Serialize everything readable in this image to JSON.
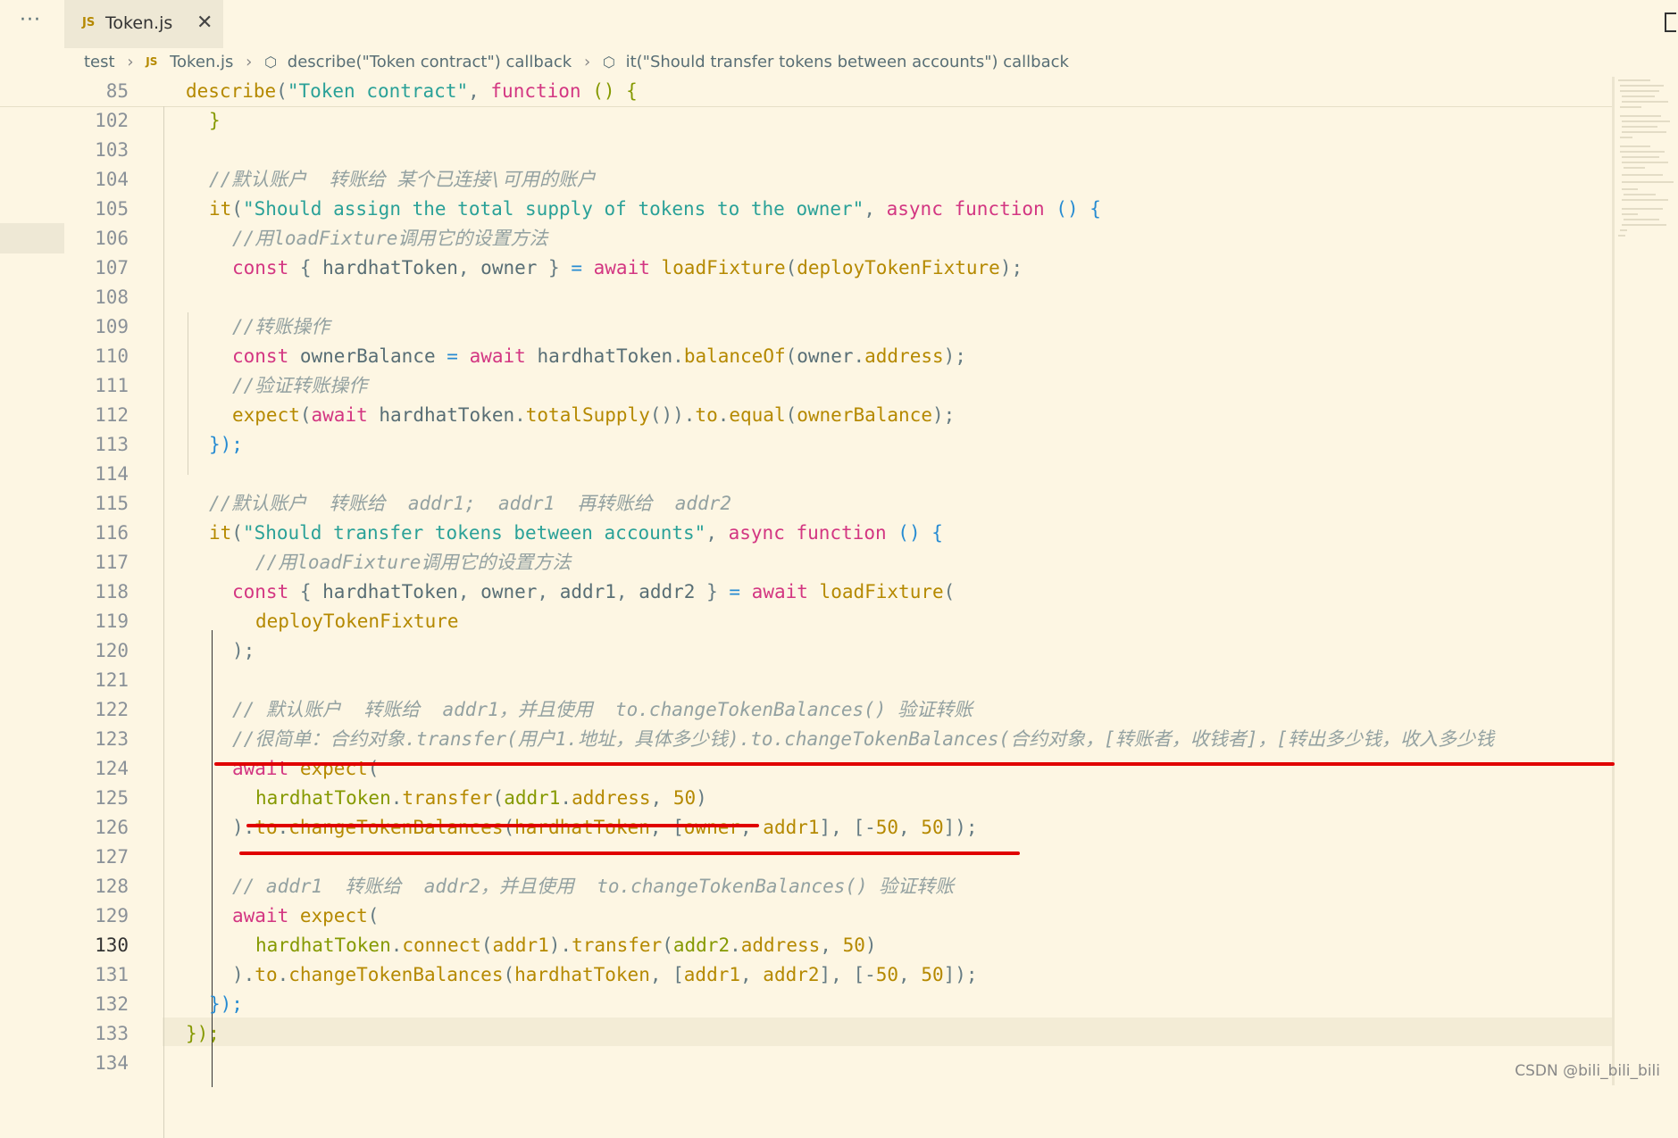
{
  "window": {
    "more_label": "···"
  },
  "tab": {
    "badge": "JS",
    "filename": "Token.js",
    "close_glyph": "✕"
  },
  "breadcrumb": {
    "items": [
      "test",
      "Token.js",
      "describe(\"Token contract\") callback",
      "it(\"Should transfer tokens between accounts\") callback"
    ],
    "js_badge": "JS"
  },
  "sticky": {
    "line_number": "85"
  },
  "lines": [
    {
      "n": "102",
      "indent": 1
    },
    {
      "n": "103"
    },
    {
      "n": "104"
    },
    {
      "n": "105"
    },
    {
      "n": "106"
    },
    {
      "n": "107"
    },
    {
      "n": "108"
    },
    {
      "n": "109"
    },
    {
      "n": "110"
    },
    {
      "n": "111"
    },
    {
      "n": "112"
    },
    {
      "n": "113"
    },
    {
      "n": "114"
    },
    {
      "n": "115"
    },
    {
      "n": "116"
    },
    {
      "n": "117"
    },
    {
      "n": "118"
    },
    {
      "n": "119"
    },
    {
      "n": "120"
    },
    {
      "n": "121"
    },
    {
      "n": "122"
    },
    {
      "n": "123"
    },
    {
      "n": "124"
    },
    {
      "n": "125"
    },
    {
      "n": "126"
    },
    {
      "n": "127"
    },
    {
      "n": "128"
    },
    {
      "n": "129"
    },
    {
      "n": "130"
    },
    {
      "n": "131"
    },
    {
      "n": "132"
    },
    {
      "n": "133"
    },
    {
      "n": "134"
    }
  ],
  "code": {
    "l85": [
      "describe",
      "(",
      "\"Token contract\"",
      ", ",
      "function",
      " () {"
    ],
    "l102": "}",
    "l104": "//默认账户  转账给 某个已连接\\可用的账户",
    "l105": [
      "it",
      "(",
      "\"Should assign the total supply of tokens to the owner\"",
      ", ",
      "async",
      " ",
      "function",
      " () {"
    ],
    "l106": "//用loadFixture调用它的设置方法",
    "l107": [
      "const",
      " { ",
      "hardhatToken",
      ", ",
      "owner",
      " } ",
      "=",
      " ",
      "await",
      " ",
      "loadFixture",
      "(",
      "deployTokenFixture",
      ");"
    ],
    "l109": "//转账操作",
    "l110": [
      "const",
      " ",
      "ownerBalance",
      " ",
      "=",
      " ",
      "await",
      " ",
      "hardhatToken",
      ".",
      "balanceOf",
      "(",
      "owner",
      ".",
      "address",
      ");"
    ],
    "l111": "//验证转账操作",
    "l112": [
      "expect",
      "(",
      "await",
      " ",
      "hardhatToken",
      ".",
      "totalSupply",
      "()).",
      "to",
      ".",
      "equal",
      "(",
      "ownerBalance",
      ");"
    ],
    "l113": "});",
    "l115": "//默认账户  转账给  addr1;  addr1  再转账给  addr2",
    "l116": [
      "it",
      "(",
      "\"Should transfer tokens between accounts\"",
      ", ",
      "async",
      " ",
      "function",
      " () {"
    ],
    "l117": "//用loadFixture调用它的设置方法",
    "l118": [
      "const",
      " { ",
      "hardhatToken",
      ", ",
      "owner",
      ", ",
      "addr1",
      ", ",
      "addr2",
      " } ",
      "=",
      " ",
      "await",
      " ",
      "loadFixture",
      "("
    ],
    "l119": "deployTokenFixture",
    "l120": ");",
    "l122": "// 默认账户  转账给  addr1，并且使用  to.changeTokenBalances() 验证转账",
    "l123": "//很简单：合约对象.transfer(用户1.地址，具体多少钱).to.changeTokenBalances(合约对象，[转账者，收钱者]，[转出多少钱，收入多少钱",
    "l124": [
      "await",
      " ",
      "expect",
      "("
    ],
    "l125": [
      "hardhatToken",
      ".",
      "transfer",
      "(",
      "addr1",
      ".",
      "address",
      ", ",
      "50",
      ")"
    ],
    "l126": [
      ").",
      "to",
      ".",
      "changeTokenBalances",
      "(",
      "hardhatToken",
      ", [",
      "owner",
      ", ",
      "addr1",
      "], [-",
      "50",
      ", ",
      "50",
      "]);"
    ],
    "l128": "// addr1  转账给  addr2，并且使用  to.changeTokenBalances() 验证转账",
    "l129": [
      "await",
      " ",
      "expect",
      "("
    ],
    "l130": [
      "hardhatToken",
      ".",
      "connect",
      "(",
      "addr1",
      ").",
      "transfer",
      "(",
      "addr2",
      ".",
      "address",
      ", ",
      "50",
      ")"
    ],
    "l131": [
      ").",
      "to",
      ".",
      "changeTokenBalances",
      "(",
      "hardhatToken",
      ", [",
      "addr1",
      ", ",
      "addr2",
      "], [-",
      "50",
      ", ",
      "50",
      "]);"
    ],
    "l132": "});",
    "l133": "});"
  },
  "current_line": "130",
  "watermark": "CSDN @bili_bili_bili",
  "colors": {
    "background": "#fdf6e3",
    "annotation_red": "#e00000",
    "keyword": "#d33682",
    "string": "#2aa198",
    "function": "#b58900",
    "comment": "#93a1a1"
  }
}
